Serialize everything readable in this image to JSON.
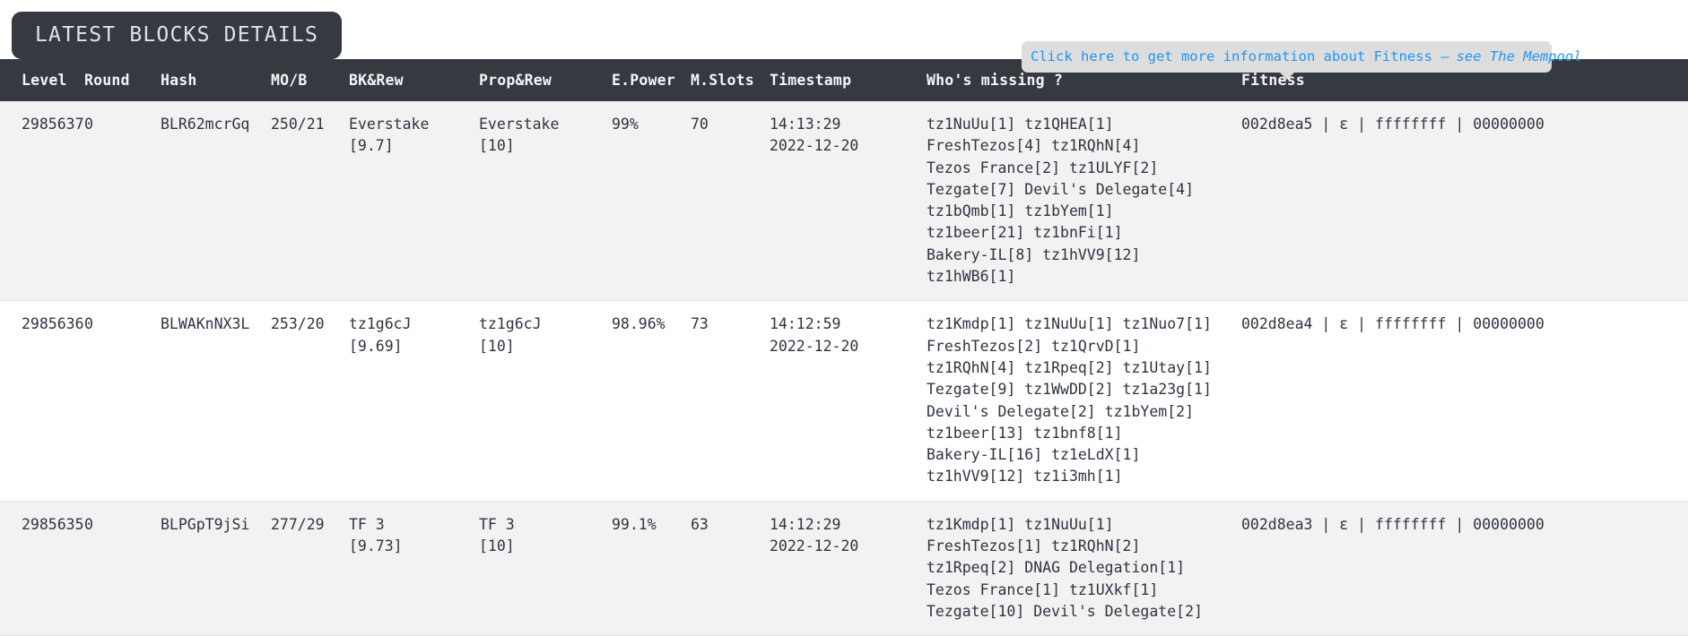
{
  "header": {
    "title": "LATEST BLOCKS DETAILS"
  },
  "info_banner": {
    "text": "Click here to get more information about Fitness —",
    "link_text": "see The Mempool",
    "color": "#2196f3",
    "background": "#dddddd"
  },
  "table": {
    "columns": [
      "Level",
      "Round",
      "Hash",
      "MO/B",
      "BK&Rew",
      "Prop&Rew",
      "E.Power",
      "M.Slots",
      "Timestamp",
      "Who's missing ?",
      "Fitness"
    ],
    "rows": [
      {
        "level": "2985637",
        "round": "0",
        "hash": "BLR62mcrGq",
        "mob": "250/21",
        "bk_rew_name": "Everstake",
        "bk_rew_value": "[9.7]",
        "prop_rew_name": "Everstake",
        "prop_rew_value": "[10]",
        "epower": "99%",
        "mslots": "70",
        "time": "14:13:29",
        "date": "2022-12-20",
        "missing": [
          "tz1NuUu[1] tz1QHEA[1]",
          "FreshTezos[4] tz1RQhN[4]",
          "Tezos France[2] tz1ULYF[2]",
          "Tezgate[7] Devil's Delegate[4]",
          "tz1bQmb[1] tz1bYem[1]",
          "tz1beer[21] tz1bnFi[1]",
          "Bakery-IL[8] tz1hVV9[12]",
          "tz1hWB6[1]"
        ],
        "fitness": "002d8ea5 | ε | ffffffff | 00000000"
      },
      {
        "level": "2985636",
        "round": "0",
        "hash": "BLWAKnNX3L",
        "mob": "253/20",
        "bk_rew_name": "tz1g6cJ",
        "bk_rew_value": "[9.69]",
        "prop_rew_name": "tz1g6cJ",
        "prop_rew_value": "[10]",
        "epower": "98.96%",
        "mslots": "73",
        "time": "14:12:59",
        "date": "2022-12-20",
        "missing": [
          "tz1Kmdp[1] tz1NuUu[1] tz1Nuo7[1]",
          "FreshTezos[2] tz1QrvD[1]",
          "tz1RQhN[4] tz1Rpeq[2] tz1Utay[1]",
          "Tezgate[9] tz1WwDD[2] tz1a23g[1]",
          "Devil's Delegate[2] tz1bYem[2]",
          "tz1beer[13] tz1bnf8[1]",
          "Bakery-IL[16] tz1eLdX[1]",
          "tz1hVV9[12] tz1i3mh[1]"
        ],
        "fitness": "002d8ea4 | ε | ffffffff | 00000000"
      },
      {
        "level": "2985635",
        "round": "0",
        "hash": "BLPGpT9jSi",
        "mob": "277/29",
        "bk_rew_name": "TF 3",
        "bk_rew_value": "[9.73]",
        "prop_rew_name": "TF 3",
        "prop_rew_value": "[10]",
        "epower": "99.1%",
        "mslots": "63",
        "time": "14:12:29",
        "date": "2022-12-20",
        "missing": [
          "tz1Kmdp[1] tz1NuUu[1]",
          "FreshTezos[1] tz1RQhN[2]",
          "tz1Rpeq[2] DNAG Delegation[1]",
          "Tezos France[1] tz1UXkf[1]",
          "Tezgate[10] Devil's Delegate[2]"
        ],
        "fitness": "002d8ea3 | ε | ffffffff | 00000000"
      }
    ]
  }
}
